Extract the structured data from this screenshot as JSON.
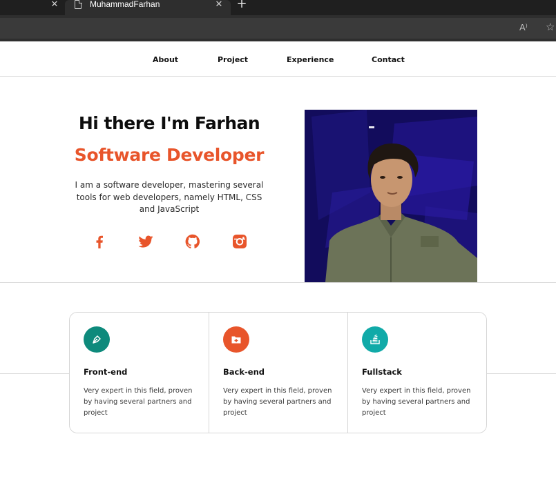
{
  "browser": {
    "tab_title": "MuhammadFarhan",
    "close_glyph": "✕",
    "new_tab_glyph": "+",
    "read_aloud_glyph": "A⁾",
    "favorite_glyph": "☆"
  },
  "nav": {
    "about": "About",
    "project": "Project",
    "experience": "Experience",
    "contact": "Contact"
  },
  "hero": {
    "title": "Hi there I'm Farhan",
    "subtitle": "Software Developer",
    "description": "I am a software developer, mastering several tools for web developers, namely HTML, CSS and JavaScript",
    "social": [
      "facebook-icon",
      "twitter-icon",
      "github-icon",
      "instagram-icon"
    ]
  },
  "services": [
    {
      "title": "Front-end",
      "text": "Very expert in this field, proven by having several partners and project",
      "icon": "pen-nib-icon",
      "color": "#0e8a7c"
    },
    {
      "title": "Back-end",
      "text": "Very expert in this field, proven by having several partners and project",
      "icon": "folder-plus-icon",
      "color": "#e8552b"
    },
    {
      "title": "Fullstack",
      "text": "Very expert in this field, proven by having several partners and project",
      "icon": "stack-icon",
      "color": "#11aaa8"
    }
  ],
  "colors": {
    "accent": "#e8552b",
    "photo_background": "#120c5c"
  }
}
